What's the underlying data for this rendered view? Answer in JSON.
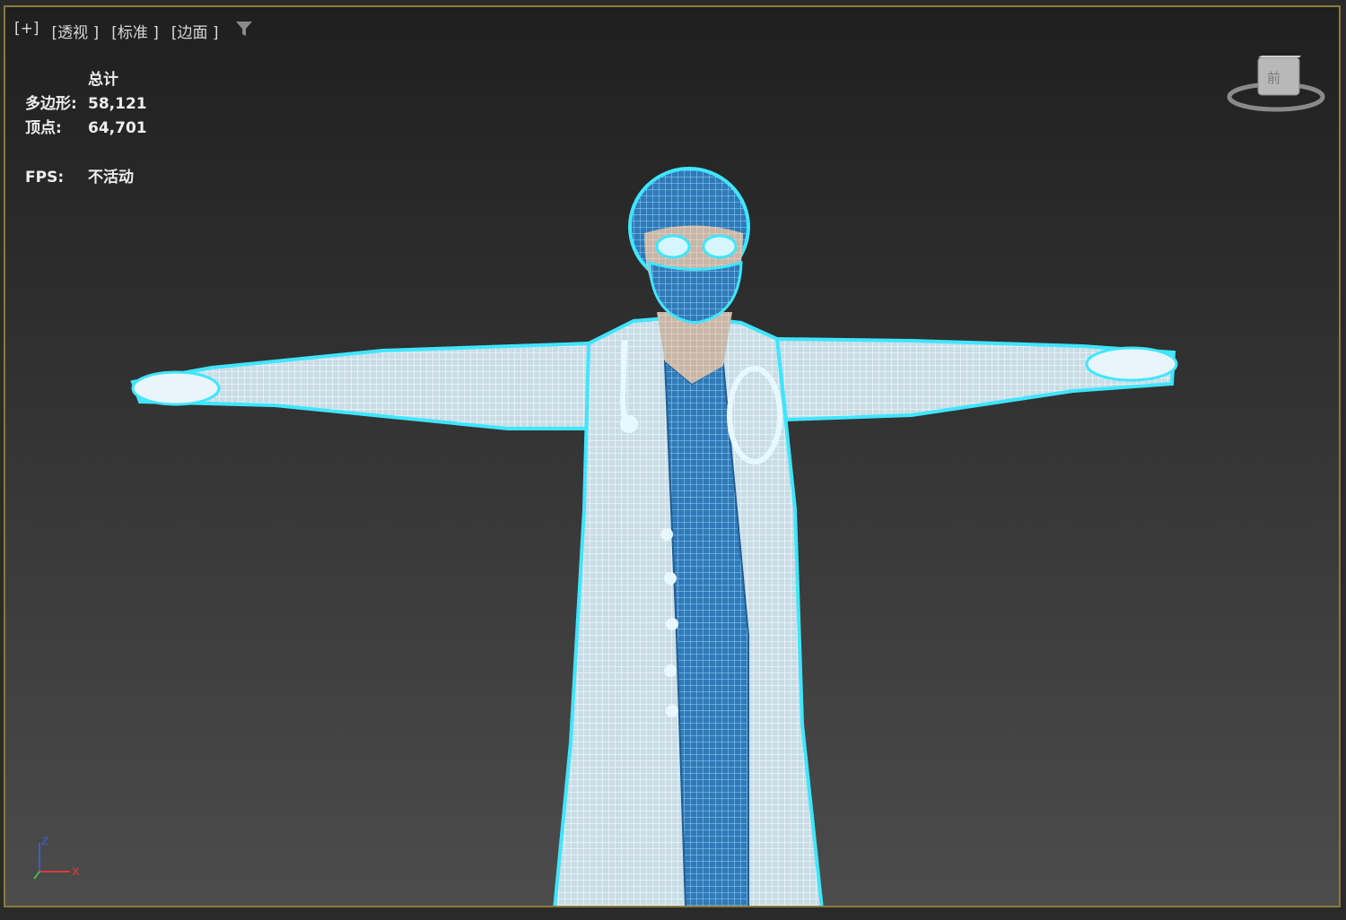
{
  "viewport": {
    "labels": [
      "[+]",
      "[透视 ]",
      "[标准 ]",
      "[边面 ]"
    ],
    "filter_icon": "filter-icon"
  },
  "stats": {
    "header": "总计",
    "polygons_label": "多边形:",
    "polygons_value": "58,121",
    "vertices_label": "顶点:",
    "vertices_value": "64,701",
    "fps_label": "FPS:",
    "fps_value": "不活动"
  },
  "viewcube": {
    "face_label": "前"
  },
  "axis": {
    "x": "x",
    "z": "z"
  },
  "colors": {
    "border": "#8a7a3c",
    "wire": "#3fe6ff",
    "mesh_light": "#d8eef5",
    "mesh_blue": "#2d79b8"
  }
}
